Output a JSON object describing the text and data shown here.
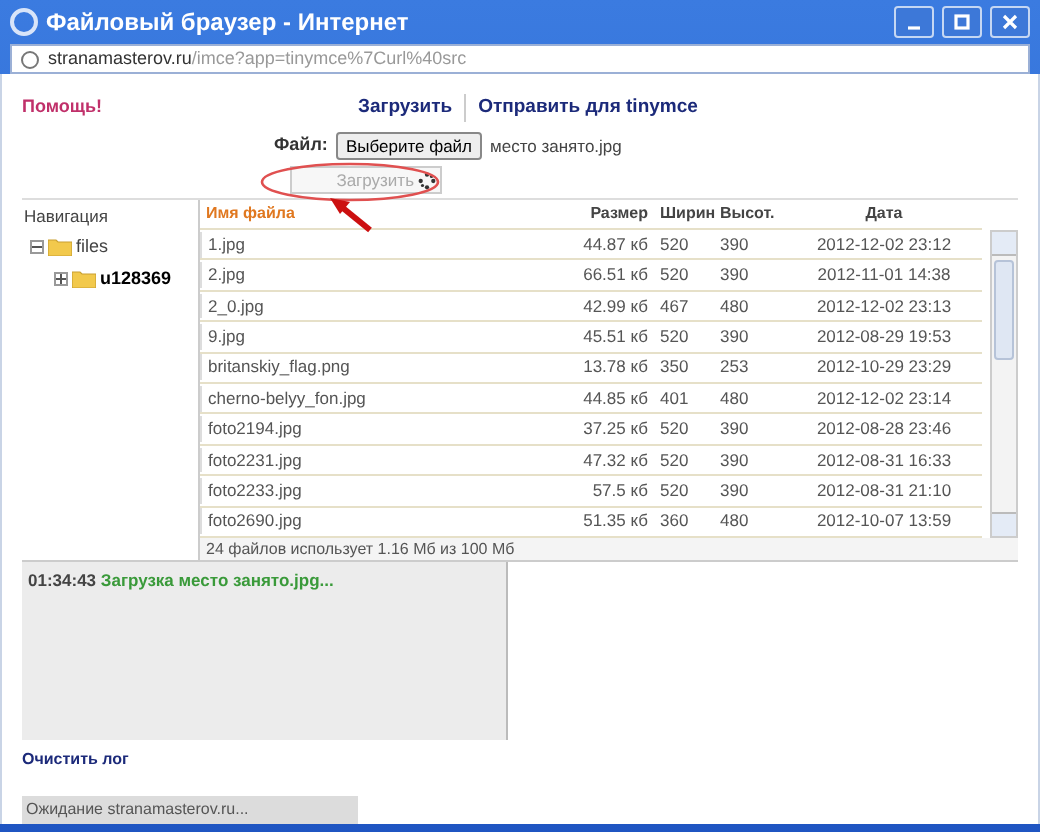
{
  "window": {
    "title": "Файловый браузер - Интернет"
  },
  "address_bar": {
    "url_host": "stranamasterov.ru",
    "url_path": "/imce?app=tinymce%7Curl%40src"
  },
  "help_link": "Помощь!",
  "tabs": [
    {
      "label": "Загрузить"
    },
    {
      "label": "Отправить для tinymce"
    }
  ],
  "upload": {
    "file_label": "Файл:",
    "choose_button": "Выберите файл",
    "file_name": "место занято.jpg",
    "submit_button": "Загрузить",
    "disabled": true
  },
  "navigation": {
    "title": "Навигация",
    "tree": [
      {
        "label": "files",
        "expanded": true,
        "selected": false,
        "children": [
          {
            "label": "u128369",
            "expanded": false,
            "selected": true
          }
        ]
      }
    ]
  },
  "table": {
    "columns": [
      "Имя файла",
      "Размер",
      "Ширин",
      "Высот.",
      "Дата"
    ],
    "rows": [
      [
        "1.jpg",
        "44.87 кб",
        "520",
        "390",
        "2012-12-02 23:12"
      ],
      [
        "2.jpg",
        "66.51 кб",
        "520",
        "390",
        "2012-11-01 14:38"
      ],
      [
        "2_0.jpg",
        "42.99 кб",
        "467",
        "480",
        "2012-12-02 23:13"
      ],
      [
        "9.jpg",
        "45.51 кб",
        "520",
        "390",
        "2012-08-29 19:53"
      ],
      [
        "britanskiy_flag.png",
        "13.78 кб",
        "350",
        "253",
        "2012-10-29 23:29"
      ],
      [
        "cherno-belyy_fon.jpg",
        "44.85 кб",
        "401",
        "480",
        "2012-12-02 23:14"
      ],
      [
        "foto2194.jpg",
        "37.25 кб",
        "520",
        "390",
        "2012-08-28 23:46"
      ],
      [
        "foto2231.jpg",
        "47.32 кб",
        "520",
        "390",
        "2012-08-31 16:33"
      ],
      [
        "foto2233.jpg",
        "57.5 кб",
        "520",
        "390",
        "2012-08-31 21:10"
      ],
      [
        "foto2690.jpg",
        "51.35 кб",
        "360",
        "480",
        "2012-10-07 13:59"
      ]
    ],
    "summary": "24 файлов использует 1.16 Мб из 100 Мб"
  },
  "log": [
    {
      "time": "01:34:43",
      "message": "Загрузка место занято.jpg..."
    }
  ],
  "clear_log": "Очистить лог",
  "status_bar": "Ожидание stranamasterov.ru..."
}
